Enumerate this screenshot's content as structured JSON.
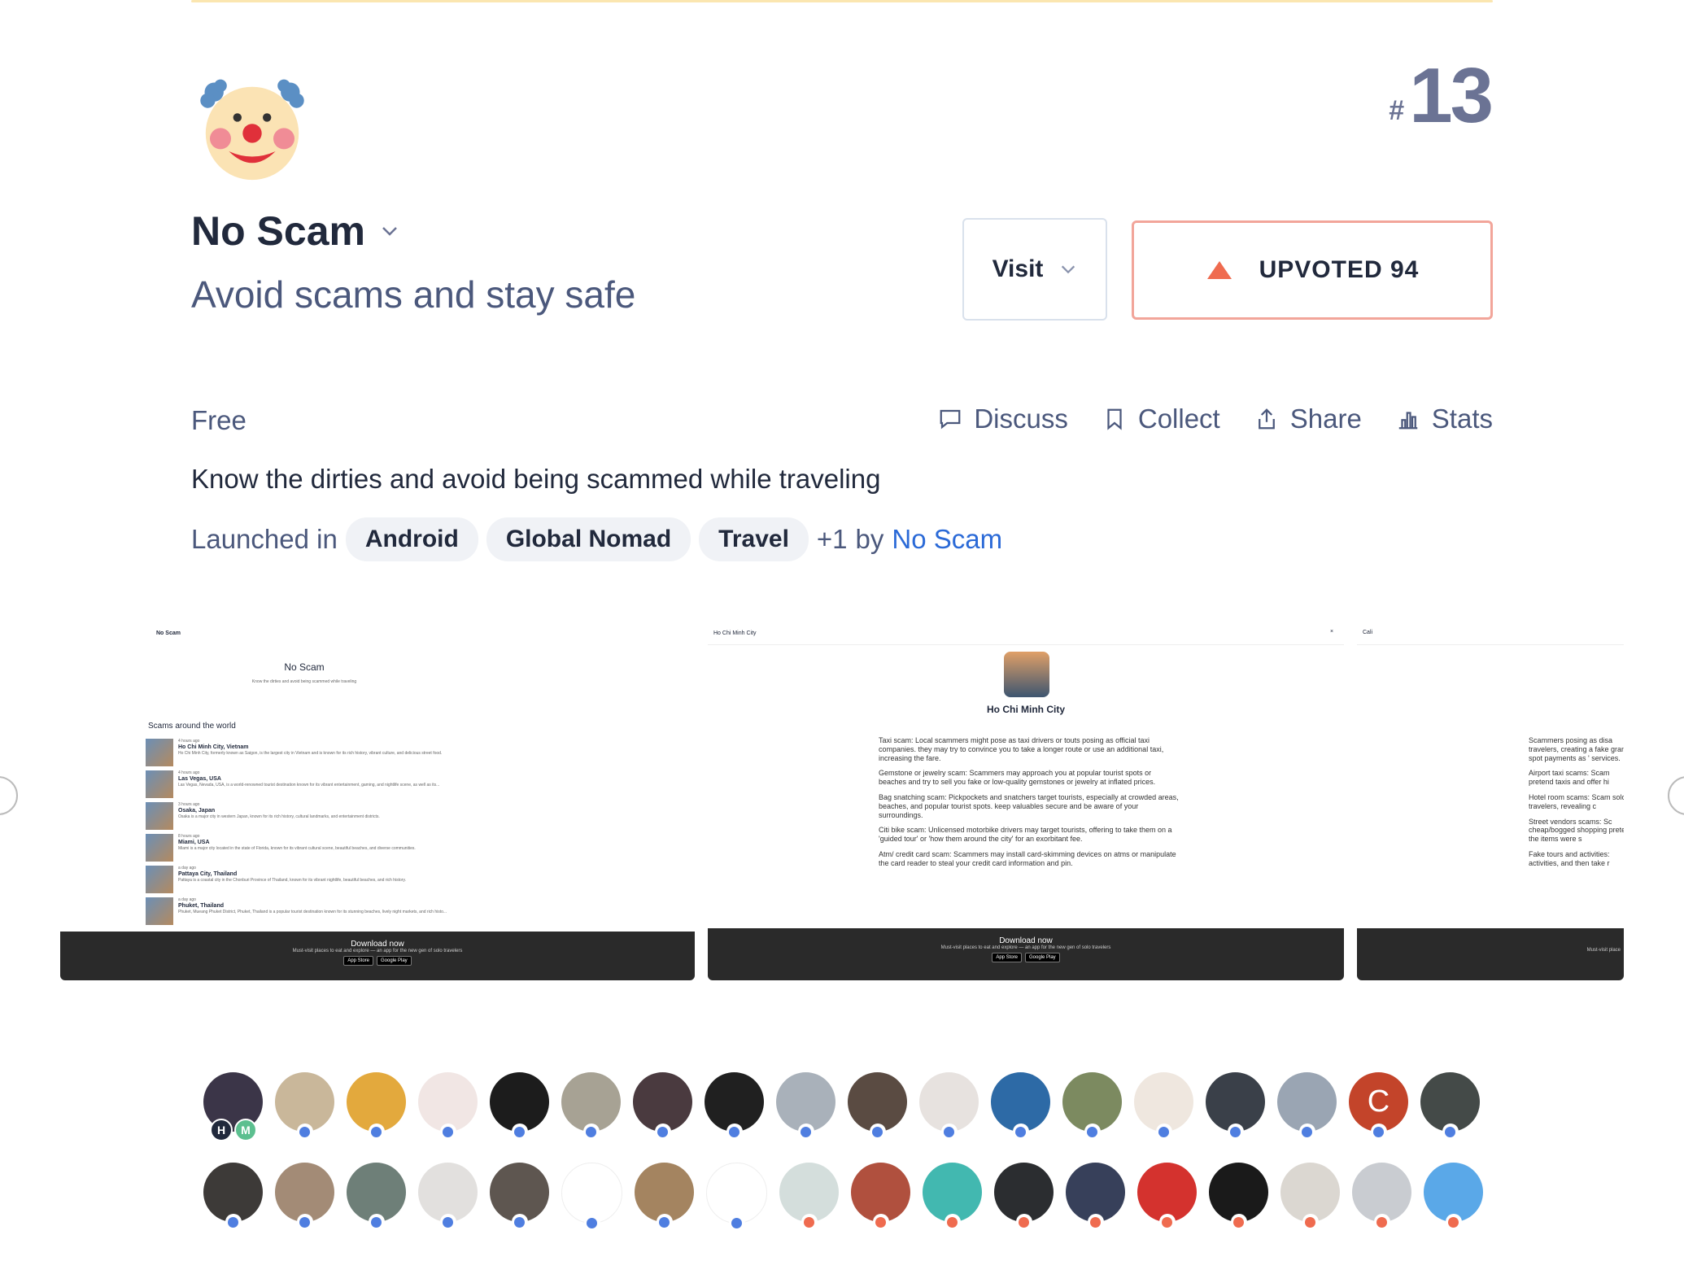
{
  "product": {
    "name": "No Scam",
    "tagline": "Avoid scams and stay safe",
    "rank_hash": "#",
    "rank": "13",
    "pricing": "Free",
    "description": "Know the dirties and avoid being scammed while traveling",
    "launched_in_label": "Launched in",
    "topics": [
      "Android",
      "Global Nomad",
      "Travel"
    ],
    "more_topics": "+1",
    "by_label": "by",
    "maker": "No Scam"
  },
  "buttons": {
    "visit": "Visit",
    "upvote": "UPVOTED 94"
  },
  "actions": {
    "discuss": "Discuss",
    "collect": "Collect",
    "share": "Share",
    "stats": "Stats"
  },
  "gallery": {
    "shot1": {
      "header": "No Scam",
      "app_name": "No Scam",
      "app_sub": "Know the dirties and avoid being scammed while traveling",
      "section": "Scams around the world",
      "rows": [
        {
          "time": "4 hours ago",
          "city": "Ho Chi Minh City, Vietnam",
          "text": "Ho Chi Minh City, formerly known as Saigon, is the largest city in Vietnam and is known for its rich history, vibrant culture, and delicious street food."
        },
        {
          "time": "4 hours ago",
          "city": "Las Vegas, USA",
          "text": "Las Vegas, Nevada, USA, is a world-renowned tourist destination known for its vibrant entertainment, gaming, and nightlife scene, as well as its..."
        },
        {
          "time": "3 hours ago",
          "city": "Osaka, Japan",
          "text": "Osaka is a major city in western Japan, known for its rich history, cultural landmarks, and entertainment districts."
        },
        {
          "time": "8 hours ago",
          "city": "Miami, USA",
          "text": "Miami is a major city located in the state of Florida, known for its vibrant cultural scene, beautiful beaches, and diverse communities."
        },
        {
          "time": "a day ago",
          "city": "Pattaya City, Thailand",
          "text": "Pattaya is a coastal city in the Chonburi Province of Thailand, known for its vibrant nightlife, beautiful beaches, and rich history."
        },
        {
          "time": "a day ago",
          "city": "Phuket, Thailand",
          "text": "Phuket, Mueang Phuket District, Phuket, Thailand is a popular tourist destination known for its stunning beaches, lively night markets, and rich histo..."
        }
      ],
      "download": "Download now",
      "download_sub": "Must-visit places to eat and explore — an app for the new gen of solo travelers",
      "app_store": "App Store",
      "google_play": "Google Play"
    },
    "shot2": {
      "search": "Ho Chi Minh City",
      "close": "×",
      "city": "Ho Chi Minh City",
      "scams": [
        "Taxi scam: Local scammers might pose as taxi drivers or touts posing as official taxi companies. they may try to convince you to take a longer route or use an additional taxi, increasing the fare.",
        "Gemstone or jewelry scam: Scammers may approach you at popular tourist spots or beaches and try to sell you fake or low-quality gemstones or jewelry at inflated prices.",
        "Bag snatching scam: Pickpockets and snatchers target tourists, especially at crowded areas, beaches, and popular tourist spots. keep valuables secure and be aware of your surroundings.",
        "Citi bike scam: Unlicensed motorbike drivers may target tourists, offering to take them on a 'guided tour' or 'how them around the city' for an exorbitant fee.",
        "Atm/ credit card scam: Scammers may install card-skimming devices on atms or manipulate the card reader to steal your credit card information and pin."
      ],
      "download": "Download now",
      "download_sub": "Must-visit places to eat and explore — an app for the new gen of solo travelers",
      "app_store": "App Store",
      "google_play": "Google Play"
    },
    "shot3": {
      "search": "Cali",
      "scams": [
        "Scammers posing as disa travelers, creating a fake grant spot payments as ' services.",
        "Airport taxi scams: Scam pretend taxis and offer hi",
        "Hotel room scams: Scam solo travelers, revealing c",
        "Street vendors scams: Sc cheap/bogged shopping pretend the items were s",
        "Fake tours and activities: activities, and then take r"
      ],
      "download_sub": "Must-visit place"
    }
  },
  "avatars_row1": [
    {
      "color": "#3b3548",
      "badge": "letters",
      "letters": [
        "H",
        "M"
      ]
    },
    {
      "color": "#c9b79a",
      "badge": "blue"
    },
    {
      "color": "#e3a93d",
      "badge": "blue"
    },
    {
      "color": "#f1e6e4",
      "badge": "blue"
    },
    {
      "color": "#1c1c1c",
      "badge": "blue"
    },
    {
      "color": "#a7a294",
      "badge": "blue"
    },
    {
      "color": "#4a3a3f",
      "badge": "blue"
    },
    {
      "color": "#202020",
      "badge": "blue"
    },
    {
      "color": "#a9b1ba",
      "badge": "blue"
    },
    {
      "color": "#5a4b42",
      "badge": "blue"
    },
    {
      "color": "#e7e2df",
      "badge": "blue"
    },
    {
      "color": "#2d6aa6",
      "badge": "blue"
    },
    {
      "color": "#7c8a60",
      "badge": "blue"
    },
    {
      "color": "#efe7df",
      "badge": "blue"
    },
    {
      "color": "#3a4049",
      "badge": "blue"
    },
    {
      "color": "#9aa5b3",
      "badge": "blue"
    },
    {
      "color": "#c3442a",
      "badge": "blue",
      "initial": "C"
    },
    {
      "color": "#444a48",
      "badge": "blue"
    }
  ],
  "avatars_row2": [
    {
      "color": "#3d3a38",
      "badge": "blue"
    },
    {
      "color": "#a38b76",
      "badge": "blue"
    },
    {
      "color": "#6e7f78",
      "badge": "blue"
    },
    {
      "color": "#e2e0de",
      "badge": "blue"
    },
    {
      "color": "#5e5650",
      "badge": "blue"
    },
    {
      "color": "#ffffff",
      "badge": "blue"
    },
    {
      "color": "#a48460",
      "badge": "blue"
    },
    {
      "color": "#ffffff",
      "badge": "blue"
    },
    {
      "color": "#d4dedc",
      "badge": "orange"
    },
    {
      "color": "#b0503e",
      "badge": "orange"
    },
    {
      "color": "#42b8b0",
      "badge": "orange"
    },
    {
      "color": "#2b2d30",
      "badge": "orange"
    },
    {
      "color": "#37405a",
      "badge": "orange"
    },
    {
      "color": "#d4322e",
      "badge": "orange"
    },
    {
      "color": "#1a1a1a",
      "badge": "orange"
    },
    {
      "color": "#dbd7d1",
      "badge": "orange"
    },
    {
      "color": "#c9ccd1",
      "badge": "orange"
    },
    {
      "color": "#5aa8e8",
      "badge": "orange"
    }
  ],
  "colors": {
    "accent": "#ef6b4f",
    "link": "#2b6ad7",
    "text": "#21293c",
    "muted": "#4b587c"
  }
}
